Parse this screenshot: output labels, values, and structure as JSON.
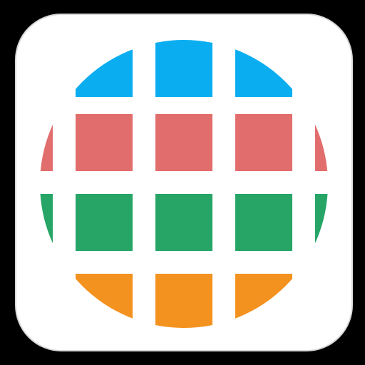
{
  "app_icon": {
    "name": "grid-globe-app-icon",
    "background_color": "#000000",
    "tile_color": "#ffffff",
    "tile_border_color": "#d8d8d8",
    "rows": [
      {
        "name": "top-row",
        "color": "#0aaef0",
        "cells": 3
      },
      {
        "name": "upper-middle-row",
        "color": "#e26d6d",
        "cells": 5
      },
      {
        "name": "lower-middle-row",
        "color": "#26a567",
        "cells": 5
      },
      {
        "name": "bottom-row",
        "color": "#f4921f",
        "cells": 3
      }
    ]
  }
}
